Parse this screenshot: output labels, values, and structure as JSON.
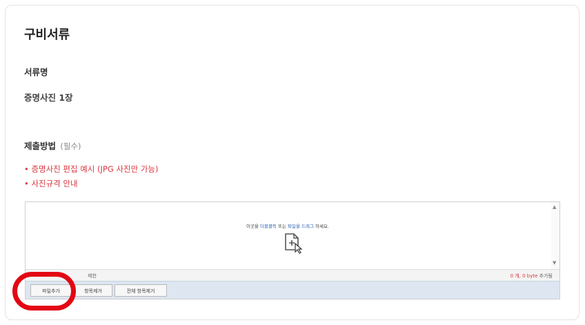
{
  "section": {
    "title": "구비서류",
    "doc_name_label": "서류명",
    "doc_name_value": "증명사진 1장",
    "method_label": "제출방법",
    "required_text": "(필수)"
  },
  "links": {
    "photo_edit_example": "• 증명사진 편집 예시 (JPG 사진만 가능)",
    "photo_spec_guide": "• 사진규격 안내"
  },
  "uploader": {
    "drop_pre": "이곳을 ",
    "drop_dblclick": "더블클릭",
    "drop_mid": " 또는 ",
    "drop_drag": "파일을 드래그",
    "drop_post": " 하세요.",
    "limit_text": "제한",
    "count_value": "0 개, 0 byte",
    "count_suffix": " 추가됨",
    "add_button": "파일추가",
    "delete_button": "항목제거",
    "delete_all_button": "전체 항목제거"
  },
  "colors": {
    "accent_red": "#d9363e",
    "button_bar": "#dde6f1",
    "highlight_ring": "#e30613"
  },
  "icons": [
    "add-file-icon",
    "scroll-up-icon",
    "scroll-down-icon"
  ]
}
